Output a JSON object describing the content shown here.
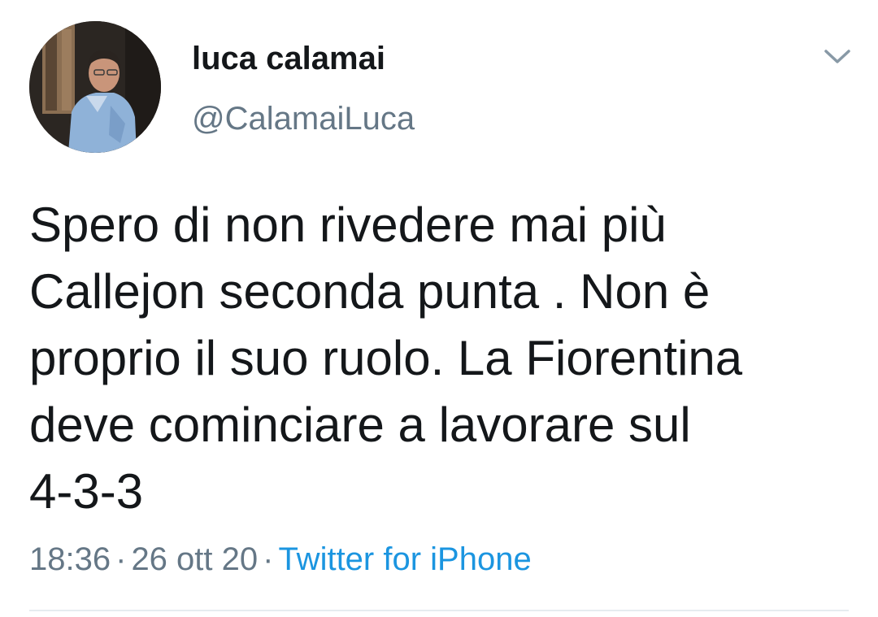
{
  "author": {
    "display_name": "luca calamai",
    "handle": "@CalamaiLuca"
  },
  "tweet": {
    "lines": [
      "Spero di non rivedere mai più",
      "Callejon seconda punta . Non è",
      "proprio il suo ruolo. La Fiorentina",
      "deve cominciare a lavorare sul",
      "4-3-3"
    ]
  },
  "meta": {
    "time": "18:36",
    "separator": "·",
    "date": "26 ott 20",
    "source": "Twitter for iPhone"
  },
  "colors": {
    "text": "#14171a",
    "secondary": "#657786",
    "link": "#1b95e0",
    "divider": "#e6ecf0"
  },
  "icons": {
    "menu": "chevron-down-icon"
  }
}
